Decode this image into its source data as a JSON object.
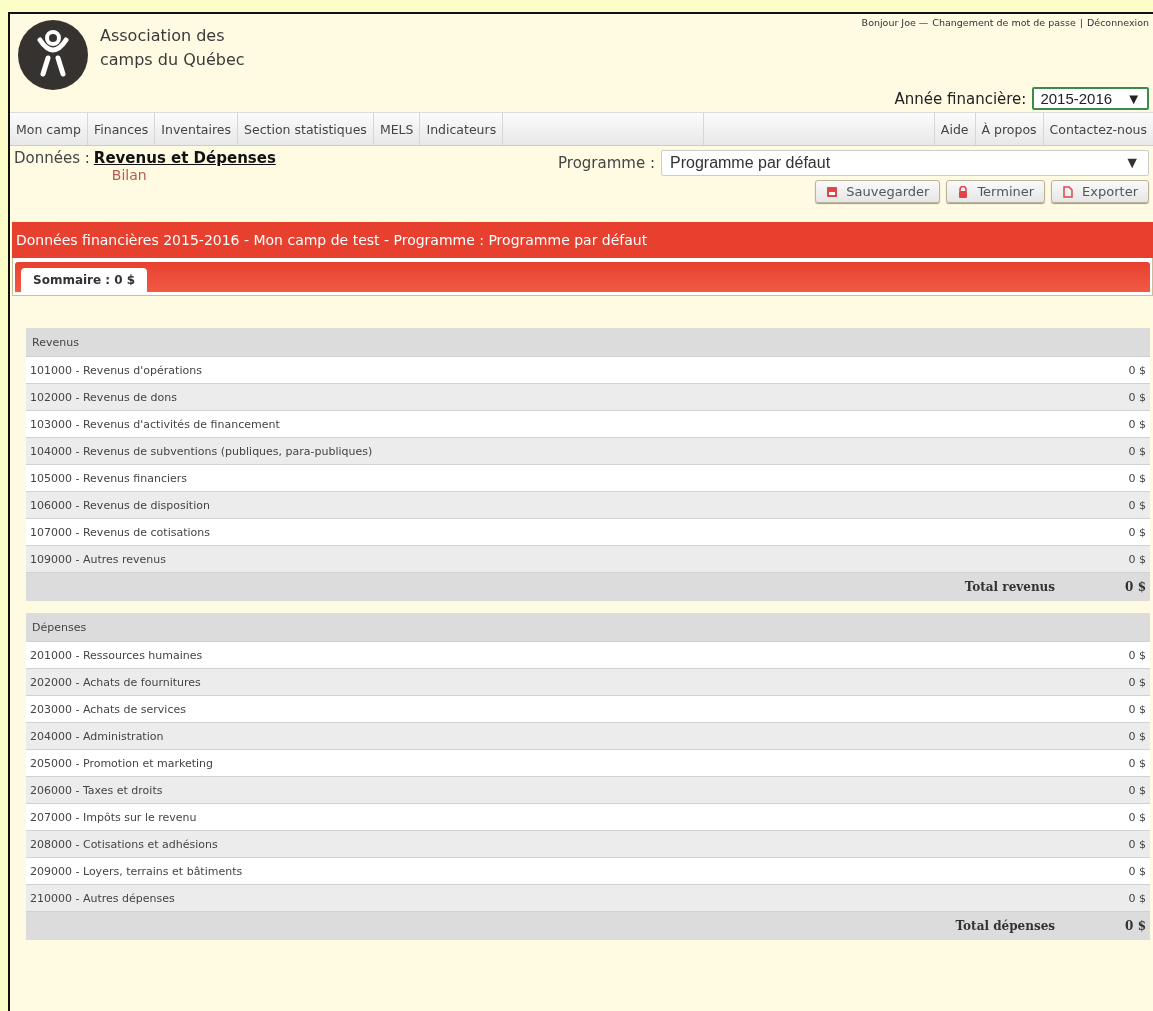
{
  "header": {
    "org_name": [
      "Association des",
      "camps du Québec"
    ],
    "user_bar": {
      "greeting": "Bonjour Joe —",
      "links": [
        "Changement de mot de passe",
        "Déconnexion"
      ],
      "separator": "|"
    },
    "fiscal_year": {
      "label": "Année financière:",
      "value": "2015-2016",
      "caret": "▼"
    }
  },
  "nav": {
    "left": [
      "Mon camp",
      "Finances",
      "Inventaires",
      "Section statistiques",
      "MELS",
      "Indicateurs"
    ],
    "right": [
      "Aide",
      "À propos",
      "Contactez-nous"
    ]
  },
  "data_section": {
    "label": "Données :",
    "links": [
      {
        "text": "Revenus et Dépenses",
        "selected": true
      },
      {
        "text": "Bilan",
        "selected": false
      }
    ]
  },
  "programme": {
    "label": "Programme :",
    "value": "Programme par défaut",
    "caret": "▼"
  },
  "buttons": [
    {
      "label": "Sauvegarder",
      "kind": "save"
    },
    {
      "label": "Terminer",
      "kind": "lock"
    },
    {
      "label": "Exporter",
      "kind": "file"
    }
  ],
  "banner": {
    "title": "Données financières 2015-2016 - Mon camp de test - Programme : Programme par défaut"
  },
  "tabs": [
    {
      "label": "Sommaire : 0 $",
      "selected": true
    }
  ],
  "sections": [
    {
      "title": "Revenus",
      "rows": [
        {
          "label": "101000 - Revenus d'opérations",
          "amount": "0 $"
        },
        {
          "label": "102000 - Revenus de dons",
          "amount": "0 $"
        },
        {
          "label": "103000 - Revenus d'activités de financement",
          "amount": "0 $"
        },
        {
          "label": "104000 - Revenus de subventions (publiques, para-publiques)",
          "amount": "0 $"
        },
        {
          "label": "105000 - Revenus financiers",
          "amount": "0 $"
        },
        {
          "label": "106000 - Revenus de disposition",
          "amount": "0 $"
        },
        {
          "label": "107000 - Revenus de cotisations",
          "amount": "0 $"
        },
        {
          "label": "109000 - Autres revenus",
          "amount": "0 $"
        }
      ],
      "total_label": "Total revenus",
      "total": "0 $"
    },
    {
      "title": "Dépenses",
      "rows": [
        {
          "label": "201000 - Ressources humaines",
          "amount": "0 $"
        },
        {
          "label": "202000 - Achats de fournitures",
          "amount": "0 $"
        },
        {
          "label": "203000 - Achats de services",
          "amount": "0 $"
        },
        {
          "label": "204000 - Administration",
          "amount": "0 $"
        },
        {
          "label": "205000 - Promotion et marketing",
          "amount": "0 $"
        },
        {
          "label": "206000 - Taxes et droits",
          "amount": "0 $"
        },
        {
          "label": "207000 - Impôts sur le revenu",
          "amount": "0 $"
        },
        {
          "label": "208000 - Cotisations et adhésions",
          "amount": "0 $"
        },
        {
          "label": "209000 - Loyers, terrains et bâtiments",
          "amount": "0 $"
        },
        {
          "label": "210000 - Autres dépenses",
          "amount": "0 $"
        }
      ],
      "total_label": "Total dépenses",
      "total": "0 $"
    }
  ]
}
